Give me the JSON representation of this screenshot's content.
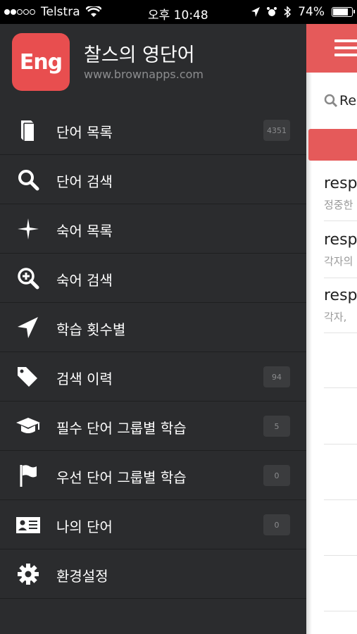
{
  "status": {
    "carrier": "Telstra",
    "time": "오후 10:48",
    "battery": "74%"
  },
  "header": {
    "logo_text": "Eng",
    "title": "찰스의 영단어",
    "url": "www.brownapps.com"
  },
  "menu": [
    {
      "label": "단어 목록",
      "icon": "book-icon",
      "badge": "4351"
    },
    {
      "label": "단어 검색",
      "icon": "search-icon",
      "badge": null
    },
    {
      "label": "숙어 목록",
      "icon": "sparkle-icon",
      "badge": null
    },
    {
      "label": "숙어 검색",
      "icon": "zoom-in-icon",
      "badge": null
    },
    {
      "label": "학습 횟수별",
      "icon": "location-arrow-icon",
      "badge": null
    },
    {
      "label": "검색 이력",
      "icon": "tags-icon",
      "badge": "94"
    },
    {
      "label": "필수 단어 그룹별 학습",
      "icon": "graduation-cap-icon",
      "badge": "5"
    },
    {
      "label": "우선 단어 그룹별 학습",
      "icon": "flag-icon",
      "badge": "0"
    },
    {
      "label": "나의 단어",
      "icon": "id-card-icon",
      "badge": "0"
    },
    {
      "label": "환경설정",
      "icon": "gear-icon",
      "badge": null
    }
  ],
  "content": {
    "search_text": "Re",
    "rows": [
      {
        "word": "resp",
        "meaning": "정중한"
      },
      {
        "word": "resp",
        "meaning": "각자의"
      },
      {
        "word": "resp",
        "meaning": "각자,"
      }
    ]
  },
  "colors": {
    "accent": "#e55a5a",
    "logo": "#e84e4f",
    "drawer": "#2b2c2e"
  }
}
